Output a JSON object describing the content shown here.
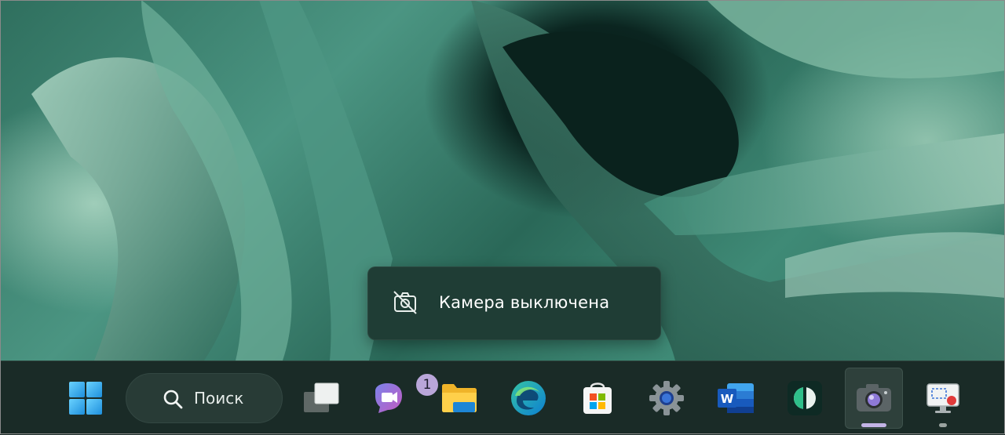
{
  "notification": {
    "text": "Камера выключена",
    "icon": "camera-off-icon"
  },
  "taskbar": {
    "start": {
      "icon": "windows-logo-icon"
    },
    "search": {
      "label": "Поиск",
      "icon": "search-icon"
    },
    "apps": [
      {
        "name": "task-view",
        "icon": "task-view-icon"
      },
      {
        "name": "teams",
        "icon": "teams-icon",
        "badge": "1"
      },
      {
        "name": "file-explorer",
        "icon": "folder-icon"
      },
      {
        "name": "edge",
        "icon": "edge-icon"
      },
      {
        "name": "microsoft-store",
        "icon": "store-icon"
      },
      {
        "name": "settings",
        "icon": "gear-icon"
      },
      {
        "name": "word",
        "icon": "word-icon"
      },
      {
        "name": "app-green",
        "icon": "dark-green-app-icon"
      },
      {
        "name": "camera",
        "icon": "camera-icon",
        "active": true
      },
      {
        "name": "snipping-tool",
        "icon": "screen-recorder-icon",
        "running": true
      }
    ]
  },
  "colors": {
    "taskbar_bg": "#1a2b27",
    "toast_bg": "#1f3d35",
    "active_indicator": "#c3b4e6",
    "running_indicator": "#9aa3a0"
  }
}
